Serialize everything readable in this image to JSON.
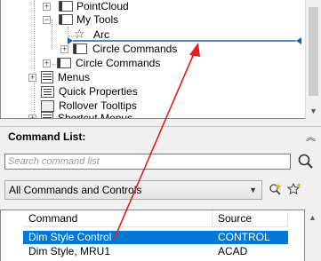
{
  "tree": {
    "items": [
      {
        "label": "PointCloud",
        "icon": "toolbar-icon"
      },
      {
        "label": "My Tools",
        "icon": "toolbar-icon"
      },
      {
        "label": "Arc",
        "icon": "star-icon"
      },
      {
        "label": "Circle Commands",
        "icon": "toolbar-icon"
      },
      {
        "label": "Circle Commands",
        "icon": "toolbar-icon"
      },
      {
        "label": "Menus",
        "icon": "menu-icon"
      },
      {
        "label": "Quick Properties",
        "icon": "quick-properties-icon"
      },
      {
        "label": "Rollover Tooltips",
        "icon": "tooltip-icon"
      },
      {
        "label": "Shortcut Menus",
        "icon": "menu-icon"
      }
    ]
  },
  "command_list": {
    "title": "Command List:",
    "search_placeholder": "Search command list",
    "filter_value": "All Commands and Controls",
    "columns": {
      "command": "Command",
      "source": "Source"
    },
    "rows": [
      {
        "command": "Dim Style Control",
        "source": "CONTROL",
        "selected": true
      },
      {
        "command": "Dim Style, MRU1",
        "source": "ACAD",
        "selected": false
      }
    ]
  },
  "colors": {
    "selection": "#0078d7",
    "drop_indicator": "#1f5fa8",
    "annotation_arrow": "#e0201c"
  }
}
